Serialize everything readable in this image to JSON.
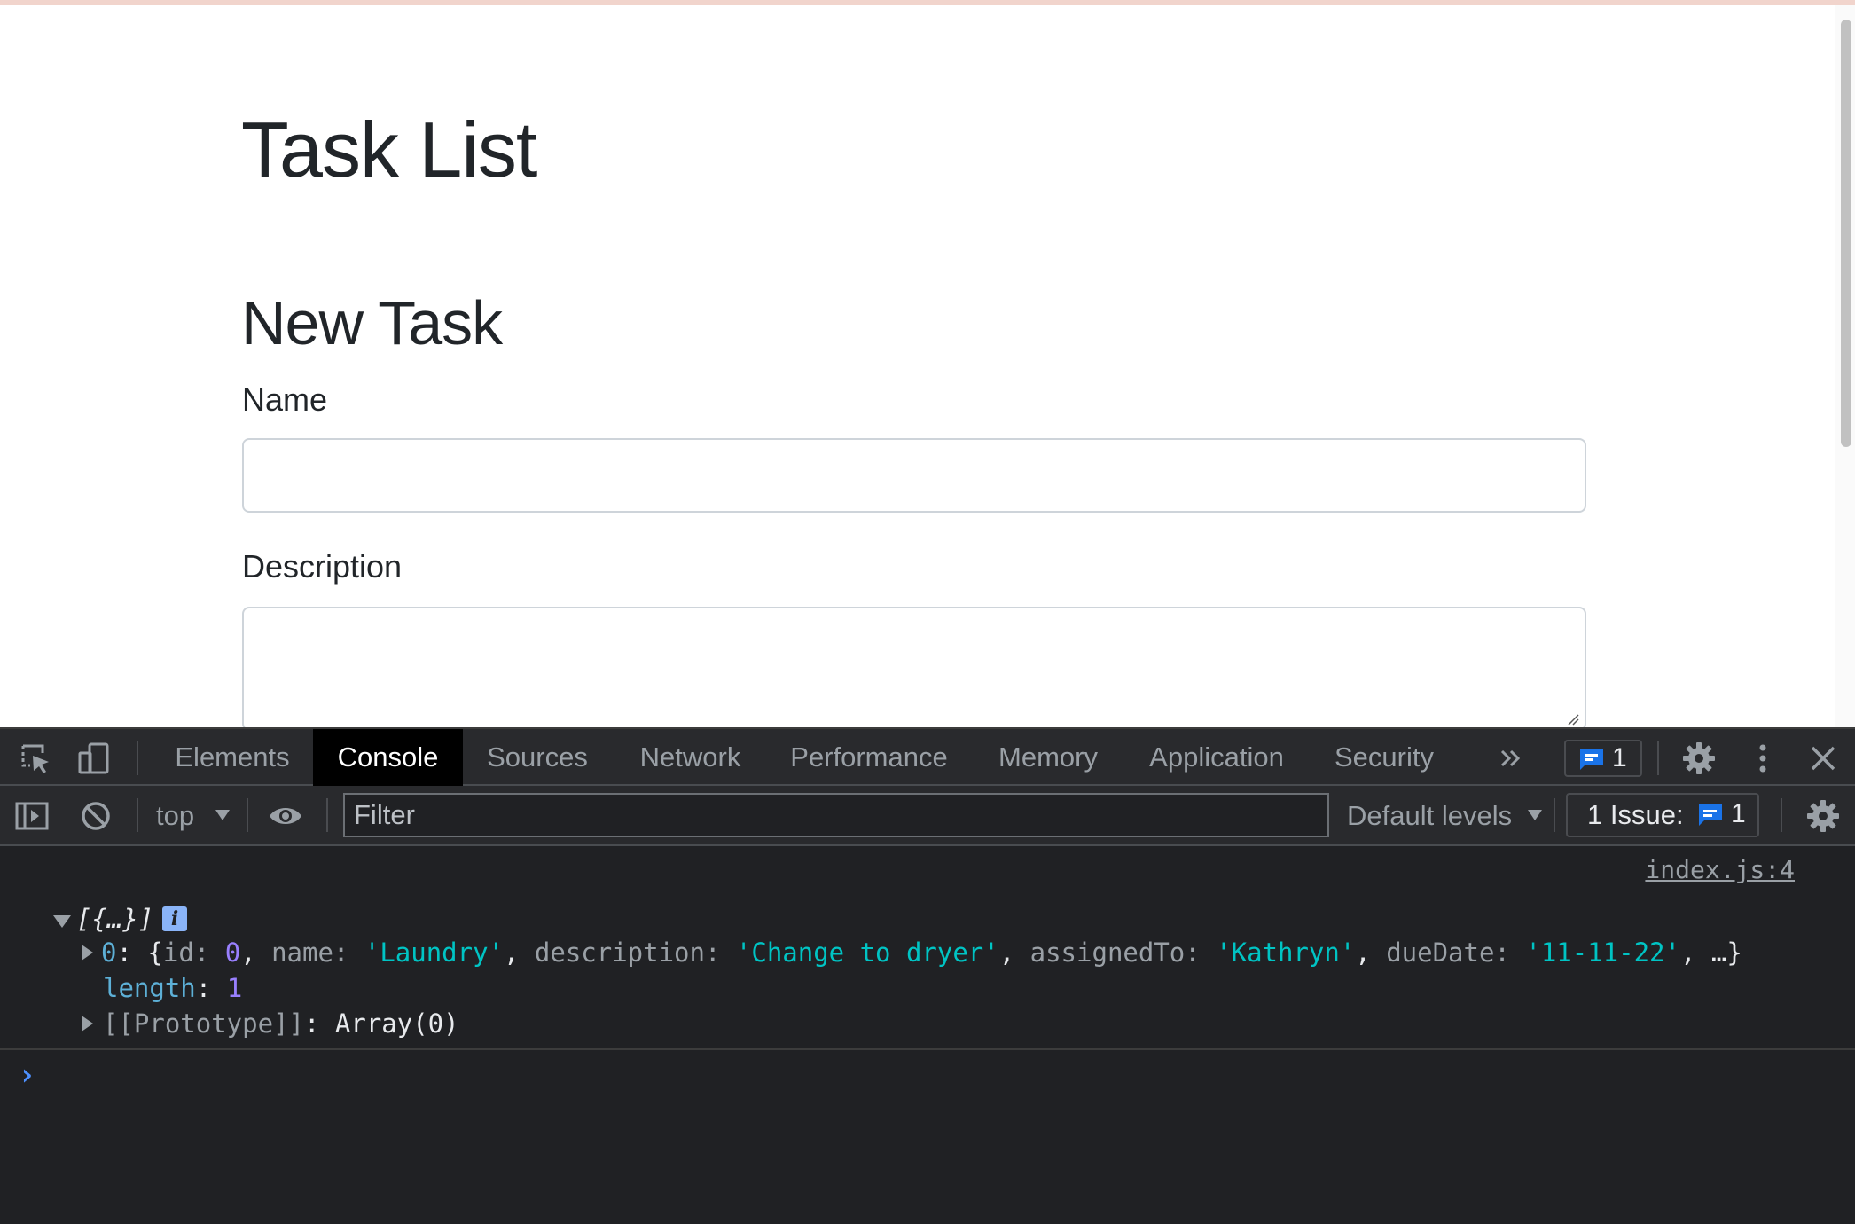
{
  "page": {
    "title": "Task List",
    "section_title": "New Task",
    "name_label": "Name",
    "description_label": "Description",
    "name_value": "",
    "description_value": ""
  },
  "devtools": {
    "tabs": [
      "Elements",
      "Console",
      "Sources",
      "Network",
      "Performance",
      "Memory",
      "Application",
      "Security"
    ],
    "active_tab": "Console",
    "issues_badge_count": "1",
    "context": "top",
    "filter_placeholder": "Filter",
    "filter_value": "",
    "levels": "Default levels",
    "issue_counter_label": "1 Issue:",
    "issue_counter_count": "1"
  },
  "console": {
    "source": "index.js:4",
    "array_summary": "[{…}]",
    "info_badge": "i",
    "item0_index": "0",
    "item0_text": "{id: 0, name: 'Laundry', description: 'Change to dryer', assignedTo: 'Kathryn', dueDate: '11-11-22', …}",
    "item0": {
      "id": "0",
      "name": "'Laundry'",
      "description": "'Change to dryer'",
      "assignedTo": "'Kathryn'",
      "dueDate": "'11-11-22'"
    },
    "length_key": "length",
    "length_value": "1",
    "prototype_key": "[[Prototype]]",
    "prototype_value": "Array(0)",
    "prompt": "›"
  },
  "colors": {
    "devtools_bg": "#202124",
    "active_tab_bg": "#000000",
    "string": "#00c4c4",
    "number": "#9980ff",
    "accent": "#1a73e8"
  }
}
